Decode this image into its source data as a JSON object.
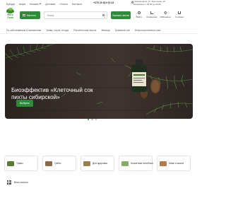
{
  "topnav": {
    "items": [
      "Бренды",
      "Акции",
      "Магазин",
      "Доставка",
      "Оплата",
      "Контакты"
    ],
    "shop_has_dropdown": true
  },
  "header": {
    "phone": "+375 29 619 00 33",
    "address": "г. Барановичи, ул. Брестская, 22 Ежедневно с 09:00 до 19:00",
    "logo_text": "Фито Сила",
    "catalog_label": "Каталог",
    "search_placeholder": "Поиск",
    "callback_label": "Заказать звонок",
    "icons": [
      {
        "name": "login",
        "label": "Войти",
        "icon": "user-icon"
      },
      {
        "name": "compare",
        "label": "Сравнение",
        "icon": "compare-icon"
      },
      {
        "name": "favorites",
        "label": "Избранное",
        "icon": "heart-icon"
      },
      {
        "name": "cart",
        "label": "Корзина",
        "icon": "cart-icon"
      }
    ]
  },
  "category_strip": [
    "По заболеваниям и назначению",
    "Травы, корни, плоды",
    "Растительные масла",
    "Живица",
    "Травяные чаи",
    "Нефотосистемные соки"
  ],
  "hero": {
    "title": "Биоэффектив «Клеточный сок пихты сибирской»",
    "button_label": "Выбрать",
    "slides_total": 3,
    "active_slide": 1
  },
  "categories": [
    {
      "label": "Травы",
      "thumb_color": "#5a7a3a"
    },
    {
      "label": "Грибы",
      "thumb_color": "#8a6a4a"
    },
    {
      "label": "Для здоровья",
      "thumb_color": "#9a8050"
    },
    {
      "label": "Косметика лечебная",
      "thumb_color": "#8aaa6a"
    },
    {
      "label": "Мази и масла",
      "thumb_color": "#b07a4a"
    }
  ],
  "all_catalog_label": "Весь каталог",
  "colors": {
    "accent": "#2e8b3a",
    "hero_bg": "#3a302b"
  }
}
